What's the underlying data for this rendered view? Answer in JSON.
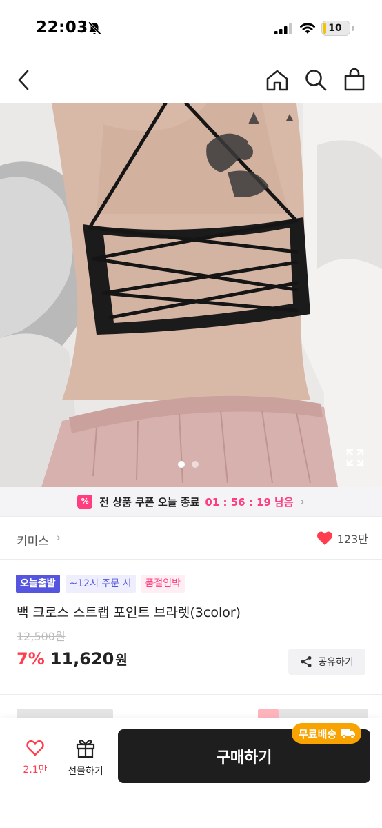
{
  "status_bar": {
    "time": "22:03",
    "battery": "10",
    "battery_level": 0.1
  },
  "nav": {
    "back_icon": "chevron-left-icon",
    "home_icon": "home-icon",
    "search_icon": "search-icon",
    "cart_icon": "shopping-bag-icon"
  },
  "carousel": {
    "current_index": 1,
    "total": 2
  },
  "coupon": {
    "icon_text": "%",
    "text": "전 상품 쿠폰 오늘 종료",
    "timer": "01 : 56 : 19 남음",
    "chevron": "›",
    "accent": "#ff3d7f"
  },
  "brand": {
    "name": "키미스",
    "chevron": "›",
    "likes": "123만"
  },
  "badges": {
    "today": "오늘출발",
    "order": "~12시 주문 시",
    "soldout": "품절임박"
  },
  "product": {
    "title": "백 크로스 스트랩 포인트 브라렛(3color)",
    "original_price": "12,500원",
    "discount": "7%",
    "price": "11,620",
    "currency": "원"
  },
  "share": {
    "label": "공유하기"
  },
  "bottom": {
    "wish_count": "2.1만",
    "gift_label": "선물하기",
    "buy_label": "구매하기",
    "shipping_badge": "무료배송",
    "buy_color": "#1e1e1e",
    "shipping_color": "#f9a300"
  }
}
